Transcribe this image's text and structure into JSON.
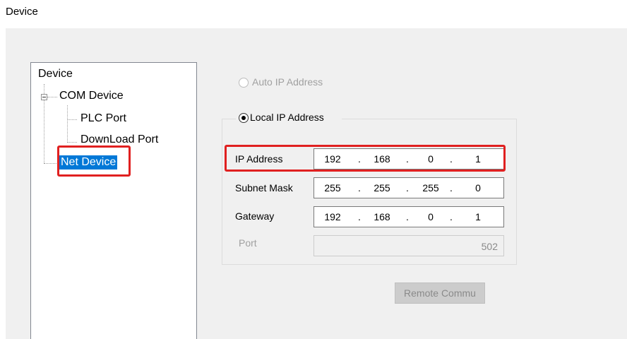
{
  "page_title": "Device",
  "tree": {
    "root": "Device",
    "com_device": "COM Device",
    "plc_port": "PLC Port",
    "download_port": "DownLoad Port",
    "net_device": "Net Device"
  },
  "network": {
    "auto_ip_label": "Auto IP Address",
    "local_ip_label": "Local IP Address",
    "ip_address": {
      "label": "IP Address",
      "octets": [
        "192",
        "168",
        "0",
        "1"
      ]
    },
    "subnet_mask": {
      "label": "Subnet Mask",
      "octets": [
        "255",
        "255",
        "255",
        "0"
      ]
    },
    "gateway": {
      "label": "Gateway",
      "octets": [
        "192",
        "168",
        "0",
        "1"
      ]
    },
    "port": {
      "label": "Port",
      "value": "502"
    },
    "dot": "."
  },
  "remote_commu_label": "Remote Commu",
  "colors": {
    "selection": "#0078d7",
    "highlight": "#e02020",
    "panel": "#f0f0f0"
  }
}
